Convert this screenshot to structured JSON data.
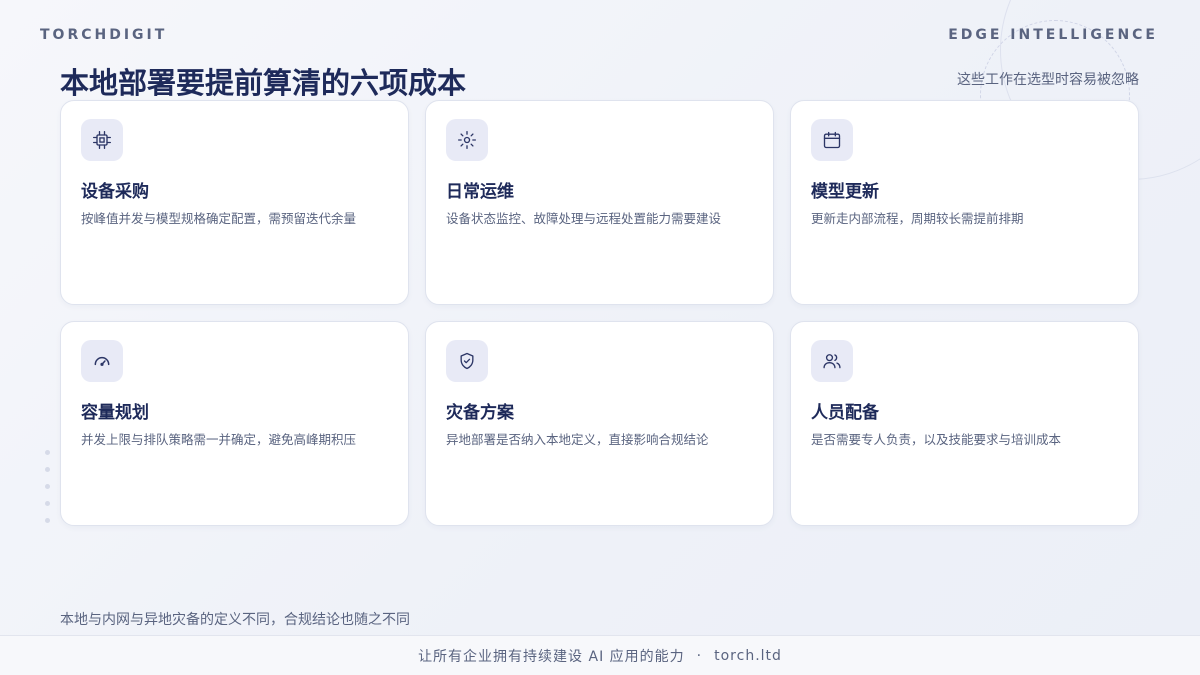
{
  "brand": {
    "left": "TORCHDIGIT",
    "right": "EDGE INTELLIGENCE"
  },
  "title": "本地部署要提前算清的六项成本",
  "subtitle": "这些工作在选型时容易被忽略",
  "cards": [
    {
      "icon": "chip-icon",
      "title": "设备采购",
      "desc": "按峰值并发与模型规格确定配置，需预留迭代余量"
    },
    {
      "icon": "gear-icon",
      "title": "日常运维",
      "desc": "设备状态监控、故障处理与远程处置能力需要建设"
    },
    {
      "icon": "calendar-icon",
      "title": "模型更新",
      "desc": "更新走内部流程，周期较长需提前排期"
    },
    {
      "icon": "gauge-icon",
      "title": "容量规划",
      "desc": "并发上限与排队策略需一并确定，避免高峰期积压"
    },
    {
      "icon": "shield-check-icon",
      "title": "灾备方案",
      "desc": "异地部署是否纳入本地定义，直接影响合规结论"
    },
    {
      "icon": "users-icon",
      "title": "人员配备",
      "desc": "是否需要专人负责，以及技能要求与培训成本"
    }
  ],
  "footnote": "本地与内网与异地灾备的定义不同，合规结论也随之不同",
  "footer": {
    "tagline": "让所有企业拥有持续建设 AI 应用的能力",
    "separator": "·",
    "site": "torch.ltd"
  },
  "colors": {
    "accent": "#1e2a5a",
    "icon_bg": "#e8eaf6",
    "muted": "#5a6480"
  }
}
